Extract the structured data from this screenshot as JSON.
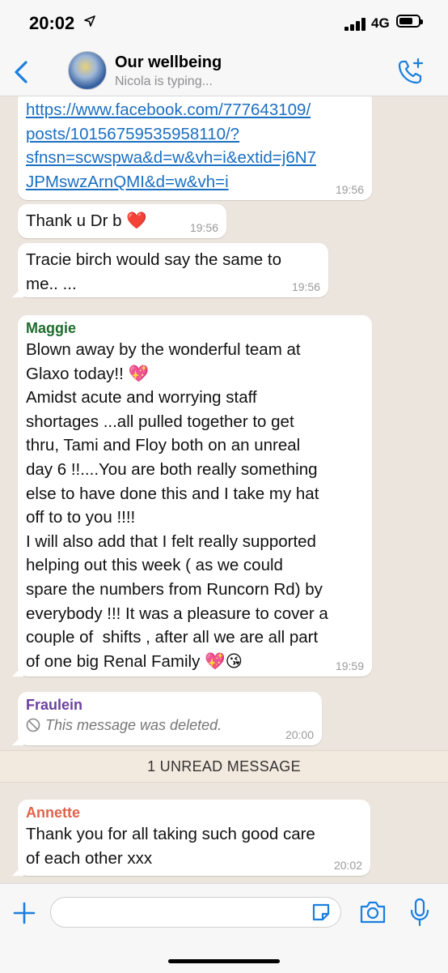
{
  "status_bar": {
    "time": "20:02",
    "network": "4G"
  },
  "header": {
    "group_name": "Our wellbeing",
    "typing_status": "Nicola is typing..."
  },
  "messages": [
    {
      "type": "link",
      "text": "https://www.facebook.com/777643109/\nposts/10156759535958110/?\nsfnsn=scwspwa&d=w&vh=i&extid=j6N7\nJPMswzArnQMI&d=w&vh=i",
      "time": "19:56"
    },
    {
      "type": "text",
      "text": "Thank u Dr b ❤️",
      "time": "19:56"
    },
    {
      "type": "text",
      "text": "Tracie birch would say the same to\nme.. ...",
      "time": "19:56"
    },
    {
      "type": "text",
      "sender": "Maggie",
      "sender_color": "#1f6b2e",
      "text": "Blown away by the wonderful team at\nGlaxo today!! 💖\nAmidst acute and worrying staff\nshortages ...all pulled together to get\nthru, Tami and Floy both on an unreal\nday 6 !!....You are both really something\nelse to have done this and I take my hat\noff to to you !!!!\nI will also add that I felt really supported\nhelping out this week ( as we could\nspare the numbers from Runcorn Rd) by\neverybody !!! It was a pleasure to cover a\ncouple of  shifts , after all we are all part\nof one big Renal Family 💖😘",
      "time": "19:59"
    },
    {
      "type": "deleted",
      "sender": "Fraulein",
      "sender_color": "#6b3fa0",
      "text": "This message was deleted.",
      "time": "20:00"
    },
    {
      "type": "text",
      "sender": "Annette",
      "sender_color": "#e0634a",
      "text": "Thank you for all taking such good care\nof each other xxx",
      "time": "20:02"
    }
  ],
  "unread_banner": "1 UNREAD MESSAGE",
  "input": {
    "placeholder": ""
  },
  "colors": {
    "link": "#1b6fc2",
    "accent": "#1a7fe0",
    "chat_bg": "#ece5dd"
  }
}
